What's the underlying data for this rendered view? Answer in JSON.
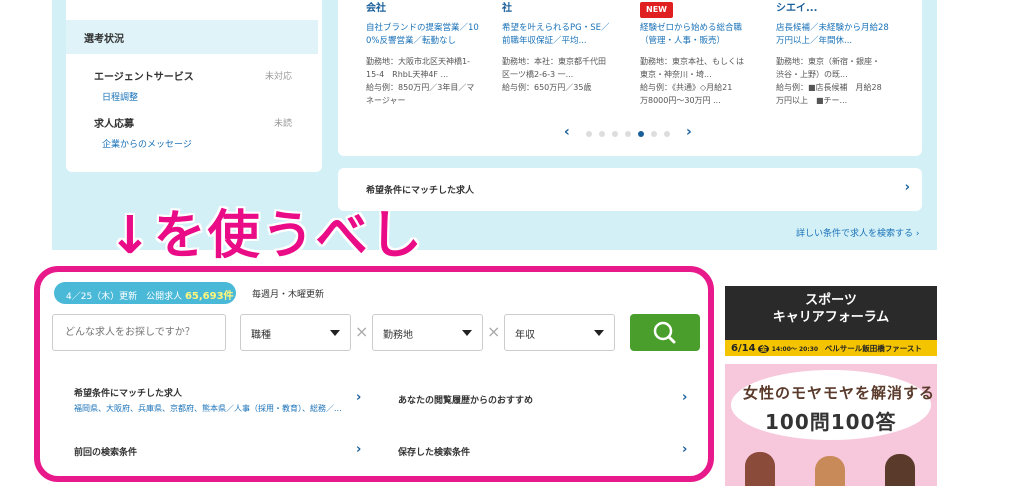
{
  "sidebar": {
    "section_title": "選考状況",
    "rows": [
      {
        "title": "エージェントサービス",
        "status": "未対応",
        "link": "日程調整"
      },
      {
        "title": "求人応募",
        "status": "未読",
        "link": "企業からのメッセージ"
      }
    ]
  },
  "job_cards": [
    {
      "company": "会社",
      "title": "自社ブランドの提案営業／10\n0%反響営業／転勤なし",
      "meta": "勤務地：大阪市北区天神橋1-\n15-4　RhbL天神4F ...\n給与例：850万円／3年目／マ\nネージャー",
      "badge": ""
    },
    {
      "company": "社",
      "title": "希望を叶えられるPG・SE／\n前職年収保証／平均...",
      "meta": "勤務地：本社：東京都千代田\n区一ツ橋2-6-3 一...\n給与例：650万円／35歳",
      "badge": ""
    },
    {
      "company": "",
      "title": "経験ゼロから始める総合職\n（管理・人事・販売）",
      "meta": "勤務地：東京本社、もしくは\n東京・神奈川・埼...\n給与例：《共通》◇月給21\n万8000円〜30万円 ...",
      "badge": "NEW"
    },
    {
      "company": "シエイ...",
      "title": "店長候補／未経験から月給28\n万円以上／年間休...",
      "meta": "勤務地：東京（新宿・銀座・\n渋谷・上野）の既...\n給与例：■店長候補　月給28\n万円以上　■チー...",
      "badge": ""
    }
  ],
  "carousel": {
    "prev": "‹",
    "next": "›",
    "dots": 8,
    "active": 5
  },
  "match_bar": {
    "label": "希望条件にマッチした求人"
  },
  "detail_link": "詳しい条件で求人を検索する ›",
  "annotation": "↓を使うべし",
  "search": {
    "update_date": "4／25（木）更新",
    "public_label": "公開求人",
    "count": "65,693件",
    "weekly_note": "毎週月・木曜更新",
    "placeholder": "どんな求人をお探しですか？",
    "selects": [
      "職種",
      "勤務地",
      "年収"
    ]
  },
  "results": [
    {
      "title": "希望条件にマッチした求人",
      "sub": "福岡県、大阪府、兵庫県、京都府、熊本県／人事（採用・教育）、総務／..."
    },
    {
      "title": "あなたの閲覧履歴からのおすすめ",
      "sub": ""
    },
    {
      "title": "前回の検索条件",
      "sub": ""
    },
    {
      "title": "保存した検索条件",
      "sub": ""
    }
  ],
  "ads": {
    "sports": {
      "line1": "スポーツ",
      "line2": "キャリアフォーラム",
      "date": "6/14",
      "day": "金",
      "time": "14:00〜\n20:30",
      "venue": "ベルサール飯田橋ファースト"
    },
    "women": {
      "line1": "女性のモヤモヤを解消する",
      "line2": "100問100答"
    }
  },
  "colors": {
    "accent_blue": "#4ab9d8",
    "link_blue": "#1a72b8",
    "search_green": "#4a9e2c",
    "highlight_pink": "#e8198b",
    "bg_light_blue": "#d3f0f7"
  }
}
